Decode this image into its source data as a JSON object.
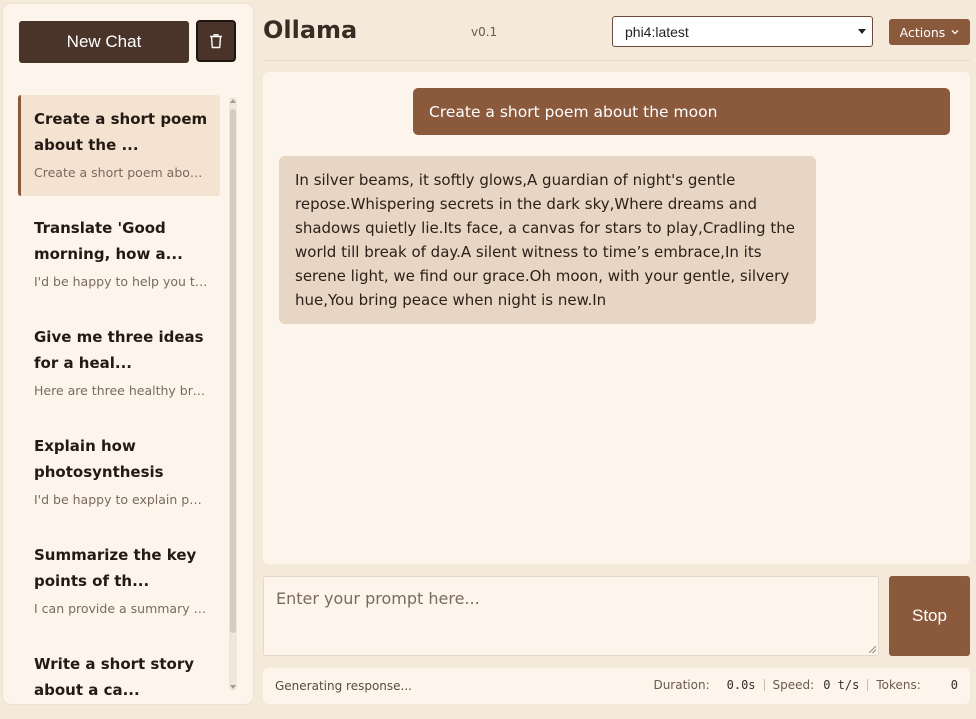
{
  "sidebar": {
    "new_chat_label": "New Chat",
    "chats": [
      {
        "title": "Create a short poem about the ...",
        "preview": "Create a short poem about the moon"
      },
      {
        "title": "Translate 'Good morning, how a...",
        "preview": "I'd be happy to help you translate"
      },
      {
        "title": "Give me three ideas for a heal...",
        "preview": "Here are three healthy breakfast ideas"
      },
      {
        "title": "Explain how photosynthesis wor...",
        "preview": "I'd be happy to explain photosynthesis"
      },
      {
        "title": "Summarize the key points of th...",
        "preview": "I can provide a summary of the key points"
      },
      {
        "title": "Write a short story about a ca...",
        "preview": ""
      }
    ]
  },
  "header": {
    "title": "Ollama",
    "version": "v0.1",
    "model": "phi4:latest",
    "actions_label": "Actions"
  },
  "messages": {
    "user": "Create a short poem about the moon",
    "assistant": "In silver beams, it softly glows,A guardian of night's gentle repose.Whispering secrets in the dark sky,Where dreams and shadows quietly lie.Its face, a canvas for stars to play,Cradling the world till break of day.A silent witness to time’s embrace,In its serene light, we find our grace.Oh moon, with your gentle, silvery hue,You bring peace when night is new.In"
  },
  "input": {
    "placeholder": "Enter your prompt here...",
    "stop_label": "Stop"
  },
  "status": {
    "text": "Generating response...",
    "duration_label": "Duration:",
    "duration_value": "0.0s",
    "speed_label": "Speed:",
    "speed_value": "0 t/s",
    "tokens_label": "Tokens:",
    "tokens_value": "0"
  },
  "colors": {
    "accent": "#8b5a3c",
    "dark": "#4a342a",
    "background": "#f5e9d9"
  }
}
